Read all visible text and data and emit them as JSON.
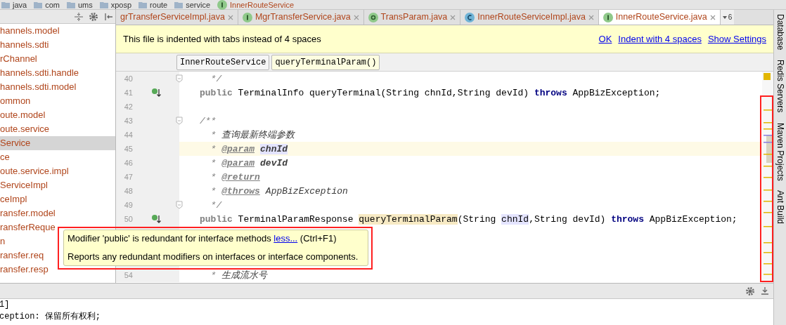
{
  "breadcrumbs": [
    {
      "label": "java",
      "kind": "folder"
    },
    {
      "label": "com",
      "kind": "folder"
    },
    {
      "label": "ums",
      "kind": "folder"
    },
    {
      "label": "xposp",
      "kind": "folder"
    },
    {
      "label": "route",
      "kind": "folder"
    },
    {
      "label": "service",
      "kind": "folder"
    },
    {
      "label": "InnerRouteService",
      "kind": "interface"
    }
  ],
  "project_panel": {
    "items": [
      {
        "label": "hannels.model",
        "selected": false
      },
      {
        "label": "hannels.sdti",
        "selected": false
      },
      {
        "label": "rChannel",
        "selected": false
      },
      {
        "label": "hannels.sdti.handle",
        "selected": false
      },
      {
        "label": "hannels.sdti.model",
        "selected": false
      },
      {
        "label": "ommon",
        "selected": false
      },
      {
        "label": "oute.model",
        "selected": false
      },
      {
        "label": "oute.service",
        "selected": false
      },
      {
        "label": "Service",
        "selected": true
      },
      {
        "label": "ce",
        "selected": false
      },
      {
        "label": "oute.service.impl",
        "selected": false
      },
      {
        "label": "ServiceImpl",
        "selected": false
      },
      {
        "label": "ceImpl",
        "selected": false
      },
      {
        "label": "ransfer.model",
        "selected": false
      },
      {
        "label": "ransferReque",
        "selected": false
      },
      {
        "label": "n",
        "selected": false
      },
      {
        "label": "ransfer.req",
        "selected": false
      },
      {
        "label": "ransfer.resp",
        "selected": false
      }
    ]
  },
  "tabs": [
    {
      "label": "grTransferServiceImpl.java",
      "kind": "plain",
      "selected": false
    },
    {
      "label": "MgrTransferService.java",
      "kind": "interface",
      "selected": false
    },
    {
      "label": "TransParam.java",
      "kind": "annotation",
      "selected": false
    },
    {
      "label": "InnerRouteServiceImpl.java",
      "kind": "class",
      "selected": false
    },
    {
      "label": "InnerRouteService.java",
      "kind": "interface",
      "selected": true
    }
  ],
  "tab_overflow": "6",
  "notification": {
    "message": "This file is indented with tabs instead of 4 spaces",
    "actions": [
      "OK",
      "Indent with 4 spaces",
      "Show Settings"
    ]
  },
  "structure_path": [
    {
      "label": "InnerRouteService",
      "selected": false
    },
    {
      "label": "queryTerminalParam()",
      "selected": true
    }
  ],
  "code_lines": [
    {
      "number": "40",
      "fold_marker": true,
      "implements_marker": false,
      "current": false,
      "tokens": [
        {
          "kind": "comment",
          "text": "  */"
        }
      ]
    },
    {
      "number": "41",
      "fold_marker": false,
      "implements_marker": true,
      "current": false,
      "tokens": [
        {
          "kind": "redundant",
          "text": "public"
        },
        {
          "kind": "plain",
          "text": " TerminalInfo queryTerminal(String chnId,String devId) "
        },
        {
          "kind": "keyword",
          "text": "throws"
        },
        {
          "kind": "plain",
          "text": " AppBizException;"
        }
      ]
    },
    {
      "number": "42",
      "fold_marker": false,
      "implements_marker": false,
      "current": false
    },
    {
      "number": "43",
      "fold_marker": true,
      "implements_marker": false,
      "current": false,
      "tokens": [
        {
          "kind": "comment",
          "text": "/**"
        }
      ]
    },
    {
      "number": "44",
      "fold_marker": false,
      "implements_marker": false,
      "current": false,
      "tokens": [
        {
          "kind": "comment",
          "text": "  * "
        },
        {
          "kind": "doc",
          "text": "查询最新终端参数"
        }
      ]
    },
    {
      "number": "45",
      "fold_marker": false,
      "implements_marker": false,
      "current": true,
      "tokens": [
        {
          "kind": "comment",
          "text": "  * "
        },
        {
          "kind": "tag",
          "text": "@param"
        },
        {
          "kind": "param-ref",
          "text": "chnId"
        }
      ]
    },
    {
      "number": "46",
      "fold_marker": false,
      "implements_marker": false,
      "current": false,
      "tokens": [
        {
          "kind": "comment",
          "text": "  * "
        },
        {
          "kind": "tag",
          "text": "@param"
        },
        {
          "kind": "param",
          "text": "devId"
        }
      ]
    },
    {
      "number": "47",
      "fold_marker": false,
      "implements_marker": false,
      "current": false,
      "tokens": [
        {
          "kind": "comment",
          "text": "  * "
        },
        {
          "kind": "tag",
          "text": "@return"
        }
      ]
    },
    {
      "number": "48",
      "fold_marker": false,
      "implements_marker": false,
      "current": false,
      "tokens": [
        {
          "kind": "comment",
          "text": "  * "
        },
        {
          "kind": "tag",
          "text": "@throws"
        },
        {
          "kind": "doc",
          "text": "AppBizException"
        }
      ]
    },
    {
      "number": "49",
      "fold_marker": true,
      "implements_marker": false,
      "current": false,
      "tokens": [
        {
          "kind": "comment",
          "text": "  */"
        }
      ]
    },
    {
      "number": "50",
      "fold_marker": false,
      "implements_marker": true,
      "current": false,
      "tokens": [
        {
          "kind": "redundant",
          "text": "public"
        },
        {
          "kind": "plain",
          "text": " TerminalParamResponse "
        },
        {
          "kind": "method-ref",
          "text": "queryTerminalParam"
        },
        {
          "kind": "plain",
          "text": "(String "
        },
        {
          "kind": "usage",
          "text": "chnId"
        },
        {
          "kind": "plain",
          "text": ",String devId) "
        },
        {
          "kind": "keyword",
          "text": "throws"
        },
        {
          "kind": "plain",
          "text": " AppBizException;"
        }
      ]
    },
    {
      "number": "54",
      "fold_marker": false,
      "implements_marker": false,
      "current": false,
      "tokens": [
        {
          "kind": "comment",
          "text": "  * "
        },
        {
          "kind": "doc",
          "text": "生成流水号"
        }
      ]
    }
  ],
  "inspection_tooltip": {
    "message": "Modifier 'public' is redundant for interface methods",
    "link": "less...",
    "shortcut": "(Ctrl+F1)",
    "description": "Reports any redundant modifiers on interfaces or interface components."
  },
  "bottom_panel": {
    "lines": [
      "1]",
      "ception: 保留所有权利;"
    ]
  },
  "tool_windows": [
    "Database",
    "Redis Servers",
    "Maven Projects",
    "Ant Build"
  ]
}
